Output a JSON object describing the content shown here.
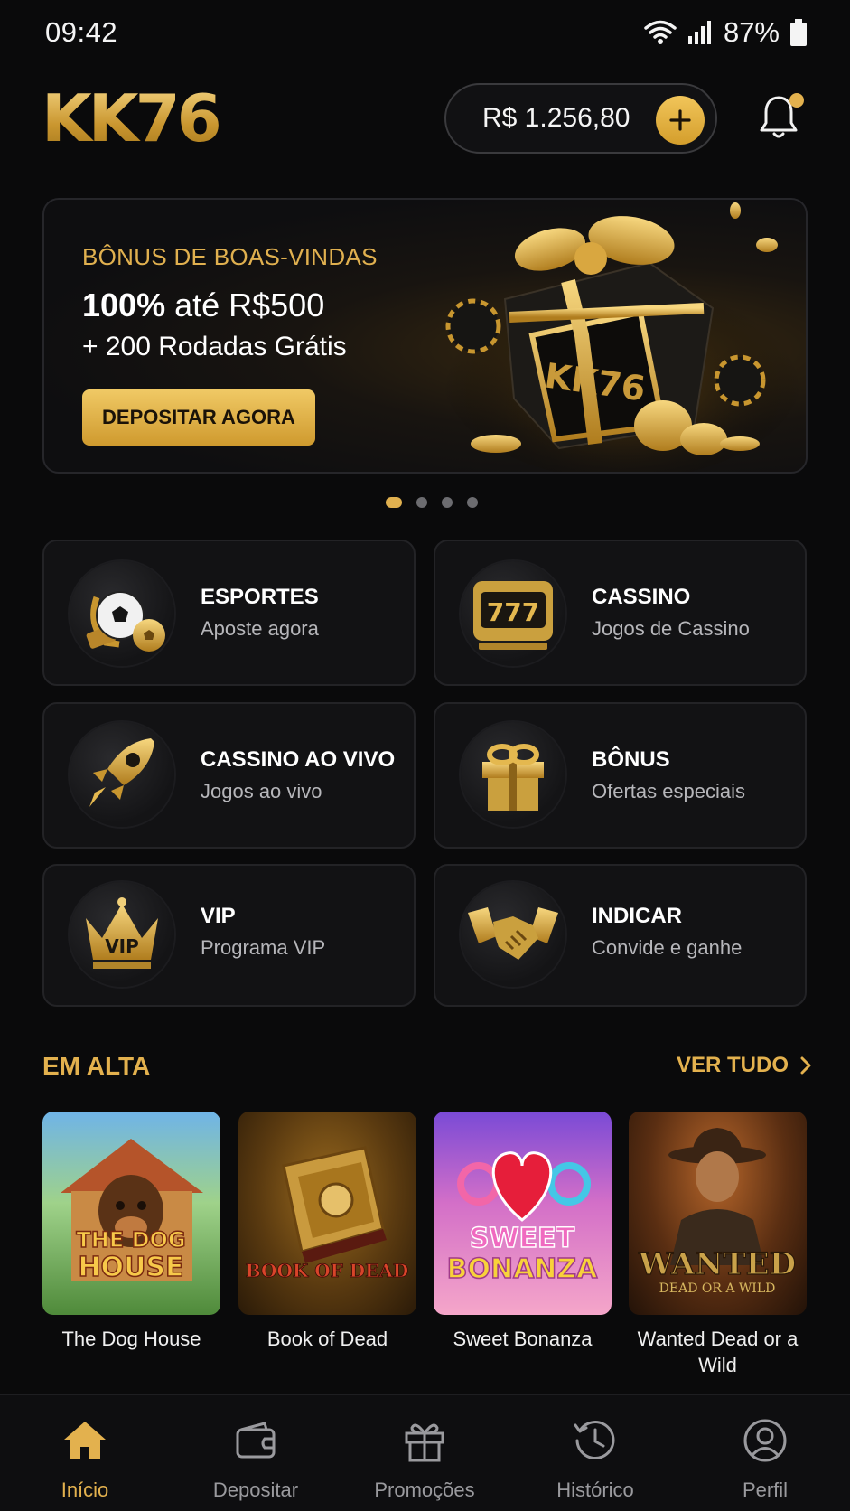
{
  "status_bar": {
    "time": "09:42",
    "battery": "87%"
  },
  "header": {
    "logo": "KK76",
    "balance": "R$ 1.256,80"
  },
  "banner": {
    "eyebrow": "BÔNUS DE BOAS-VINDAS",
    "headline_bold": "100%",
    "headline_rest": " até R$500",
    "sub": "+ 200 Rodadas Grátis",
    "cta": "DEPOSITAR AGORA",
    "art_logo": "KK76",
    "pages": 4,
    "active_page": 1
  },
  "categories": [
    {
      "title": "ESPORTES",
      "subtitle": "Aposte agora",
      "icon": "soccer-ball-icon"
    },
    {
      "title": "CASSINO",
      "subtitle": "Jogos de Cassino",
      "icon": "slot-machine-icon"
    },
    {
      "title": "CASSINO AO VIVO",
      "subtitle": "Jogos ao vivo",
      "icon": "rocket-icon"
    },
    {
      "title": "BÔNUS",
      "subtitle": "Ofertas especiais",
      "icon": "gift-icon"
    },
    {
      "title": "VIP",
      "subtitle": "Programa VIP",
      "icon": "crown-icon",
      "badge": "VIP"
    },
    {
      "title": "INDICAR",
      "subtitle": "Convide e ganhe",
      "icon": "handshake-icon"
    }
  ],
  "slot_digits": "777",
  "trending": {
    "title": "EM ALTA",
    "see_all": "VER TUDO",
    "games": [
      {
        "name": "The Dog House",
        "art_line1": "THE DOG",
        "art_line2": "HOUSE"
      },
      {
        "name": "Book of Dead",
        "art_line1": "BOOK OF DEAD"
      },
      {
        "name": "Sweet Bonanza",
        "art_line1": "SWEET",
        "art_line2": "BONANZA"
      },
      {
        "name": "Wanted Dead or a Wild",
        "art_line1": "WANTED",
        "art_line2": "DEAD OR A WILD"
      }
    ]
  },
  "bottom_nav": [
    {
      "label": "Início",
      "icon": "home-icon",
      "active": true
    },
    {
      "label": "Depositar",
      "icon": "wallet-icon",
      "active": false
    },
    {
      "label": "Promoções",
      "icon": "gift-icon",
      "active": false
    },
    {
      "label": "Histórico",
      "icon": "history-icon",
      "active": false
    },
    {
      "label": "Perfil",
      "icon": "profile-icon",
      "active": false
    }
  ],
  "colors": {
    "gold": "#e3b14e",
    "background": "#0a0a0b",
    "card": "#121214"
  }
}
